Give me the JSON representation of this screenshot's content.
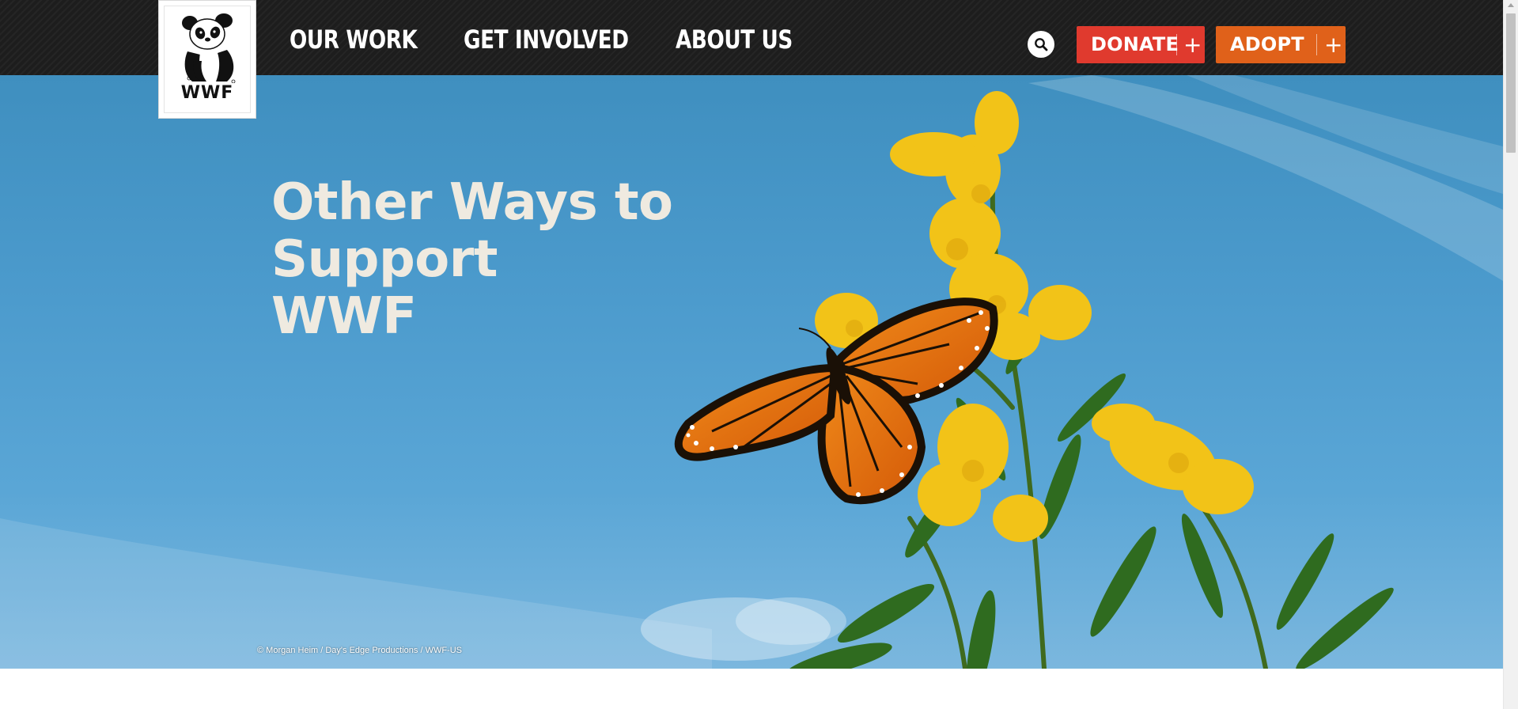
{
  "header": {
    "logo_text": "WWF",
    "nav": [
      {
        "label": "OUR WORK"
      },
      {
        "label": "GET INVOLVED"
      },
      {
        "label": "ABOUT US"
      }
    ],
    "search_icon": "search-icon",
    "donate_label": "DONATE",
    "adopt_label": "ADOPT",
    "plus_glyph": "+"
  },
  "hero": {
    "title_line1": "Other Ways to Support",
    "title_line2": "WWF",
    "photo_credit": "© Morgan Heim / Day's Edge Productions / WWF-US"
  },
  "colors": {
    "header_bg": "#1d1d1d",
    "donate": "#e03a2e",
    "adopt": "#e0611a",
    "title": "#efeae0",
    "sky": "#4b9acc"
  }
}
